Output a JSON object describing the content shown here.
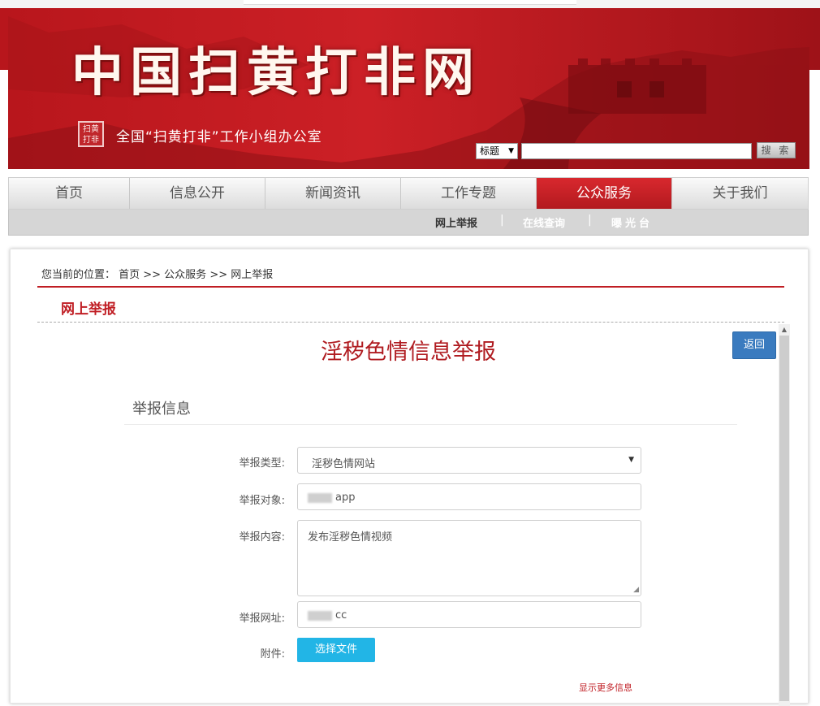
{
  "header": {
    "site_title": "中国扫黄打非网",
    "seal_text": "扫黄 打非",
    "subtitle": "全国“扫黄打非”工作小组办公室",
    "search": {
      "scope_value": "标题",
      "button": "搜 索"
    }
  },
  "nav": {
    "items": [
      {
        "label": "首页"
      },
      {
        "label": "信息公开"
      },
      {
        "label": "新闻资讯"
      },
      {
        "label": "工作专题"
      },
      {
        "label": "公众服务",
        "active": true
      },
      {
        "label": "关于我们"
      }
    ],
    "sub_items": [
      {
        "label": "网上举报"
      },
      {
        "label": "在线查询"
      },
      {
        "label": "曝光台"
      }
    ],
    "sub_separator": "|"
  },
  "breadcrumb": {
    "text": "您当前的位置： 首页 >> 公众服务 >> 网上举报"
  },
  "section_title": "网上举报",
  "form": {
    "title": "淫秽色情信息举报",
    "back_button": "返回",
    "info_heading": "举报信息",
    "fields": {
      "type_label": "举报类型:",
      "type_value": "淫秽色情网站",
      "target_label": "举报对象:",
      "target_value": "app",
      "content_label": "举报内容:",
      "content_value": "发布淫秽色情视频",
      "url_label": "举报网址:",
      "url_value": "cc",
      "attachment_label": "附件:"
    },
    "file_button": "选择文件",
    "more_info": "显示更多信息"
  },
  "colors": {
    "brand_red": "#c01e24",
    "active_nav": "#d8282e",
    "back_button": "#3a7bbf",
    "file_button": "#22b5e6"
  },
  "icons": {
    "select_arrow": "triangle-down-icon",
    "scroll_up": "triangle-up-icon",
    "resize": "resize-grip-icon"
  }
}
